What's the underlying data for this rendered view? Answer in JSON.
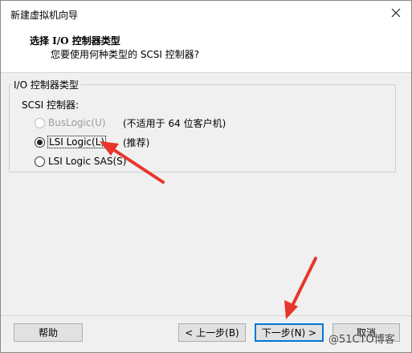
{
  "window": {
    "title": "新建虚拟机向导"
  },
  "header": {
    "title": "选择 I/O 控制器类型",
    "subtitle": "您要使用何种类型的 SCSI 控制器?"
  },
  "group": {
    "label": "I/O 控制器类型",
    "scsi_label": "SCSI 控制器:",
    "options": [
      {
        "label": "BusLogic(U)",
        "note": "(不适用于 64 位客户机)",
        "state": "disabled"
      },
      {
        "label": "LSI Logic(L)",
        "note": "(推荐)",
        "state": "selected"
      },
      {
        "label": "LSI Logic SAS(S)",
        "note": "",
        "state": "unselected"
      }
    ]
  },
  "buttons": {
    "help": "帮助",
    "back": "< 上一步(B)",
    "next": "下一步(N) >",
    "cancel": "取消"
  },
  "watermark": "@51CTO博客",
  "colors": {
    "arrow": "#e8352b",
    "focus_border": "#0078d7"
  }
}
